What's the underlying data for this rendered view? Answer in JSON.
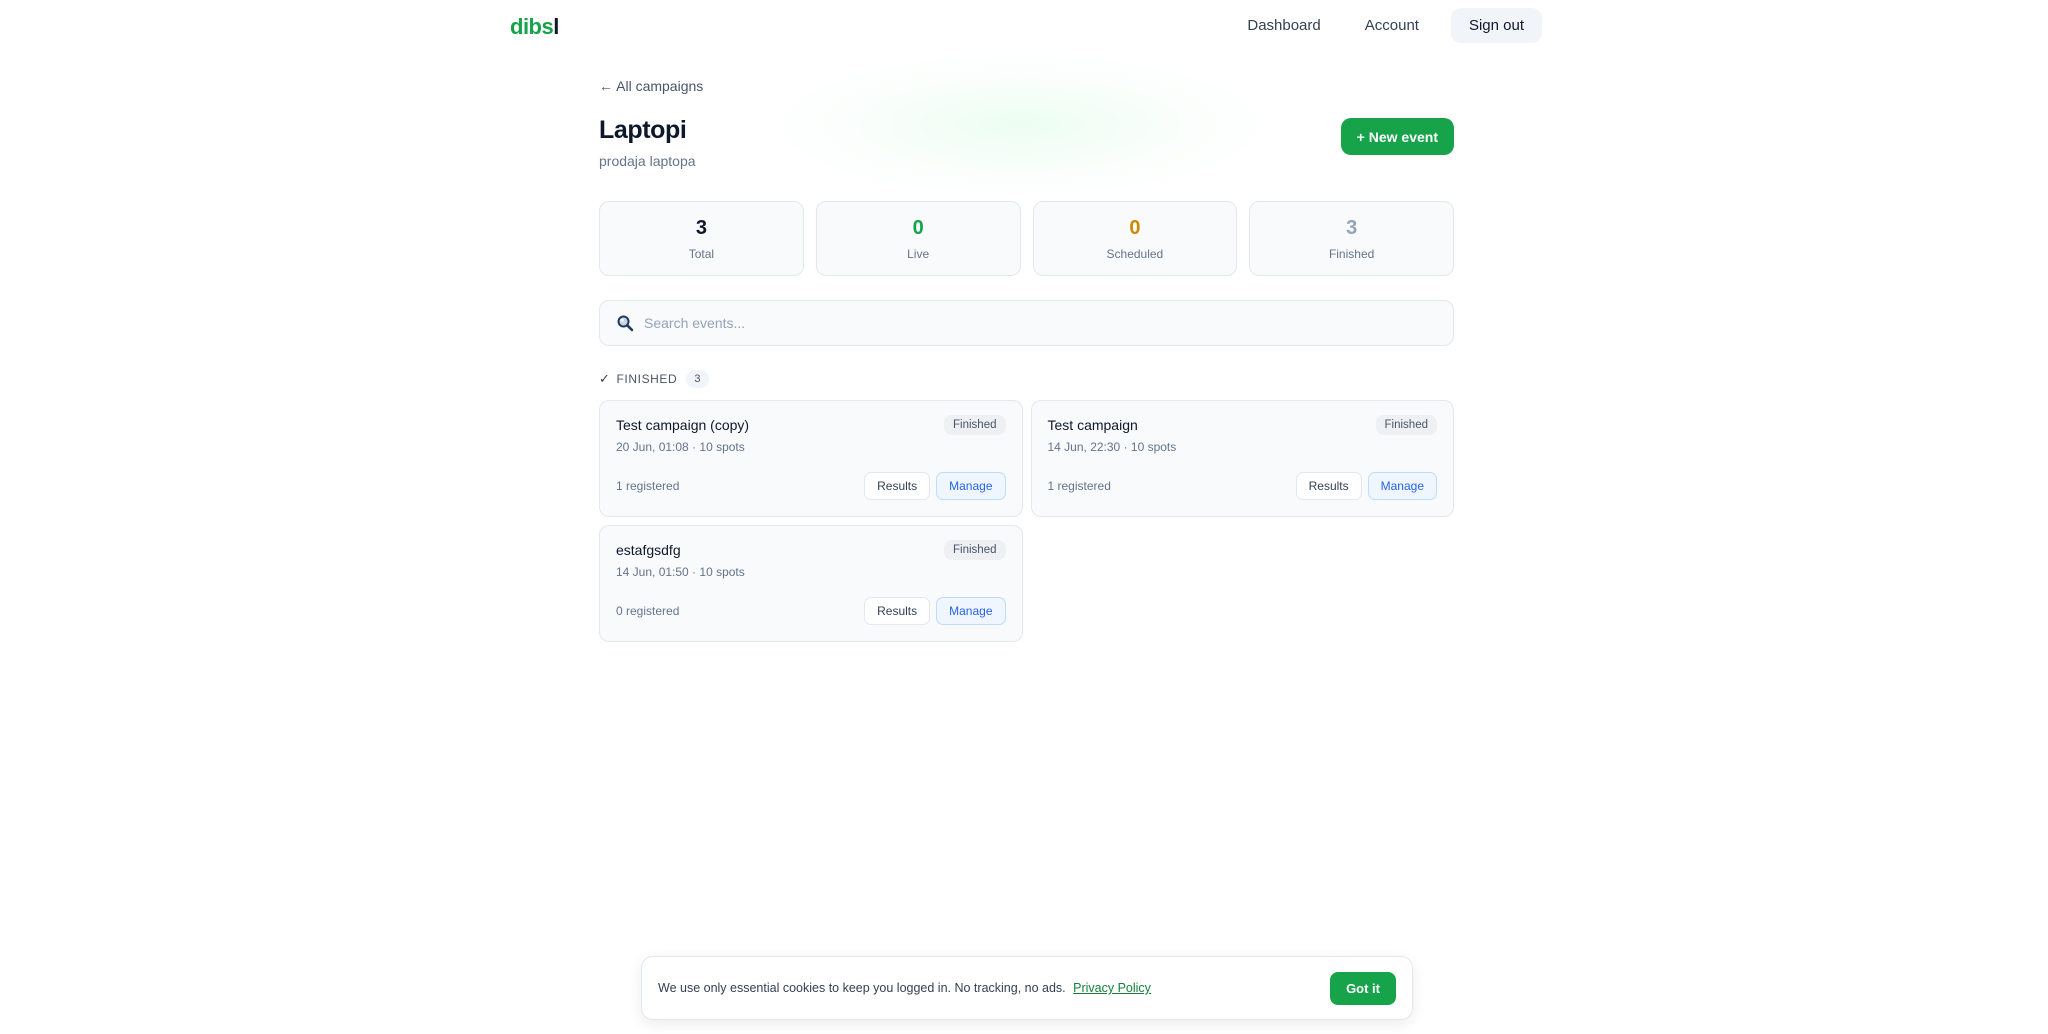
{
  "brand": {
    "logo_part1": "dibs",
    "logo_part2": "l",
    "accent_color": "#16a34a"
  },
  "nav": {
    "dashboard": "Dashboard",
    "account": "Account",
    "signout": "Sign out"
  },
  "page": {
    "back_label": "← All campaigns",
    "title": "Laptopi",
    "subtitle": "prodaja laptopa",
    "new_event_label": "+ New event"
  },
  "stats": [
    {
      "value": "3",
      "label": "Total",
      "color": "#0f172a"
    },
    {
      "value": "0",
      "label": "Live",
      "color": "#16a34a"
    },
    {
      "value": "0",
      "label": "Scheduled",
      "color": "#ca8a04"
    },
    {
      "value": "3",
      "label": "Finished",
      "color": "#94a3b8"
    }
  ],
  "search": {
    "icon": "search-icon",
    "placeholder": "Search events..."
  },
  "section": {
    "check": "✓",
    "label": "FINISHED",
    "count": "3"
  },
  "events": [
    {
      "title": "Test campaign (copy)",
      "meta": "20 Jun, 01:08 · 10 spots",
      "status": "Finished",
      "registered": "1 registered",
      "results_label": "Results",
      "manage_label": "Manage"
    },
    {
      "title": "Test campaign",
      "meta": "14 Jun, 22:30 · 10 spots",
      "status": "Finished",
      "registered": "1 registered",
      "results_label": "Results",
      "manage_label": "Manage"
    },
    {
      "title": "estafgsdfg",
      "meta": "14 Jun, 01:50 · 10 spots",
      "status": "Finished",
      "registered": "0 registered",
      "results_label": "Results",
      "manage_label": "Manage"
    }
  ],
  "cookie": {
    "text": "We use only essential cookies to keep you logged in. No tracking, no ads.",
    "link": "Privacy Policy",
    "button": "Got it"
  }
}
